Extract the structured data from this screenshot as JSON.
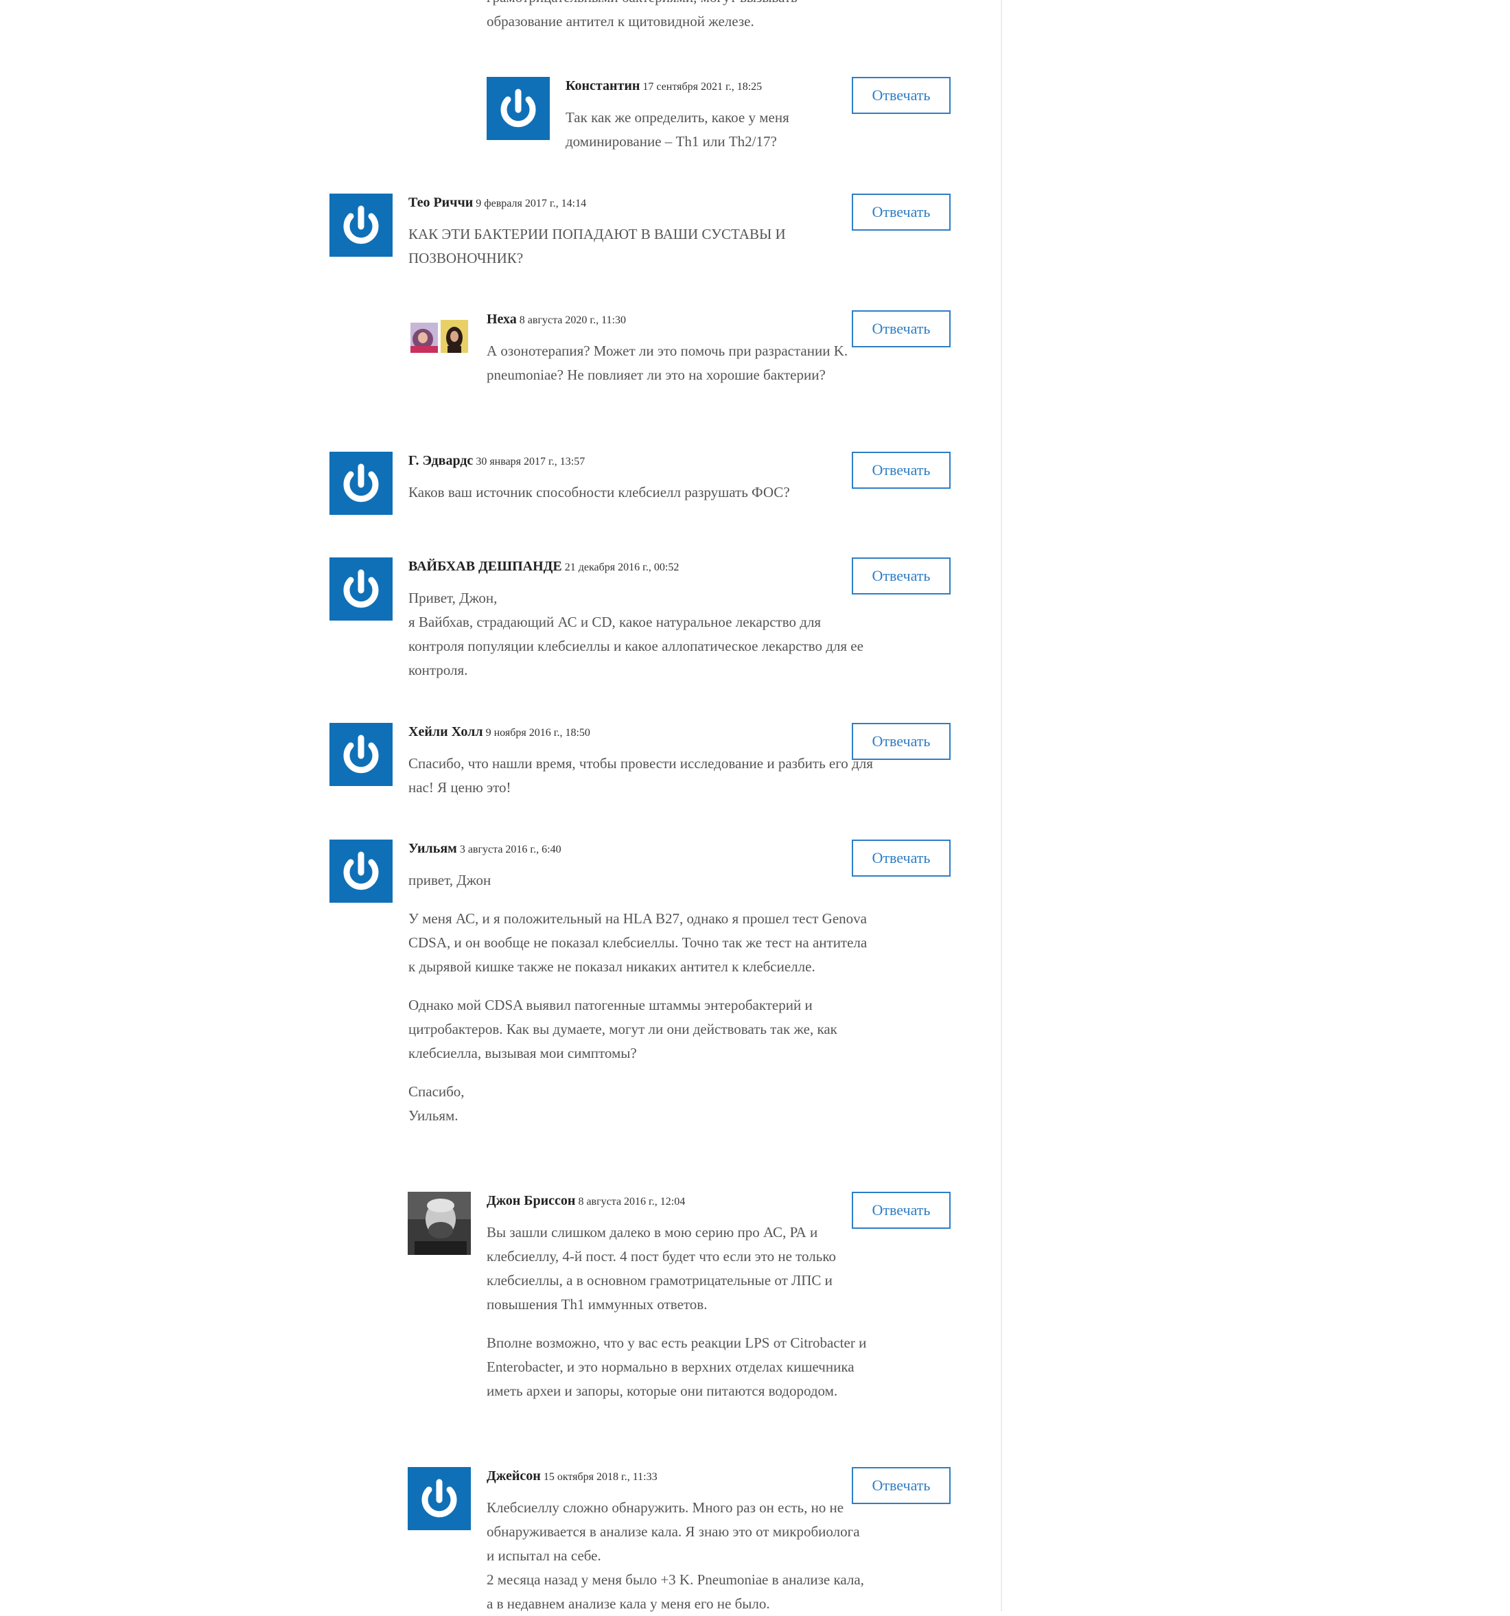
{
  "reply_label": "Отвечать",
  "accent_color": "#2e7ec5",
  "avatar_color": "#0f70b7",
  "partial_text": {
    "line1": "грамотрицательными бактериями, могут вызывать",
    "line2": "образование антител к щитовидной железе."
  },
  "comments": [
    {
      "author": "Константин",
      "date": "17 сентября 2021 г., 18:25",
      "avatar": "power-icon",
      "paragraphs": [
        "Так как же определить, какое у меня доминирование – Th1 или Th2/17?"
      ]
    },
    {
      "author": "Тео Риччи",
      "date": "9 февраля 2017 г., 14:14",
      "avatar": "power-icon",
      "paragraphs": [
        "КАК ЭТИ БАКТЕРИИ ПОПАДАЮТ В ВАШИ СУСТАВЫ И ПОЗВОНОЧНИК?"
      ]
    },
    {
      "author": "Неха",
      "date": "8 августа 2020 г., 11:30",
      "avatar": "collage-photo",
      "paragraphs": [
        "А озонотерапия? Может ли это помочь при разрастании K. pneumoniae? Не повлияет ли это на хорошие бактерии?"
      ]
    },
    {
      "author": "Г. Эдвардс",
      "date": "30 января 2017 г., 13:57",
      "avatar": "power-icon",
      "paragraphs": [
        "Каков ваш источник способности клебсиелл разрушать ФОС?"
      ]
    },
    {
      "author": "ВАЙБХАВ ДЕШПАНДЕ",
      "date": "21 декабря 2016 г., 00:52",
      "avatar": "power-icon",
      "paragraphs": [
        "Привет, Джон,",
        "я Вайбхав, страдающий АС и CD, какое натуральное лекарство для контроля популяции клебсиеллы и какое аллопатическое лекарство для ее контроля."
      ]
    },
    {
      "author": "Хейли Холл",
      "date": "9 ноября 2016 г., 18:50",
      "avatar": "power-icon",
      "paragraphs": [
        "Спасибо, что нашли время, чтобы провести исследование и разбить его для нас! Я ценю это!"
      ]
    },
    {
      "author": "Уильям",
      "date": "3 августа 2016 г., 6:40",
      "avatar": "power-icon",
      "paragraphs": [
        "привет, Джон",
        "У меня АС, и я положительный на HLA B27, однако я прошел тест Genova CDSA, и он вообще не показал клебсиеллы. Точно так же тест на антитела к дырявой кишке также не показал никаких антител к клебсиелле.",
        "Однако мой CDSA выявил патогенные штаммы энтеробактерий и цитробактеров. Как вы думаете, могут ли они действовать так же, как клебсиелла, вызывая мои симптомы?",
        "Спасибо,",
        "Уильям."
      ]
    },
    {
      "author": "Джон Бриссон",
      "date": "8 августа 2016 г., 12:04",
      "avatar": "portrait-photo",
      "paragraphs": [
        "Вы зашли слишком далеко в мою серию про АС, РА и клебсиеллу, 4-й пост. 4 пост будет что если это не только клебсиеллы, а в основном грамотрицательные от ЛПС и повышения Th1 иммунных ответов.",
        "Вполне возможно, что у вас есть реакции LPS от Citrobacter и Enterobacter, и это нормально в верхних отделах кишечника иметь археи и запоры, которые они питаются водородом."
      ]
    },
    {
      "author": "Джейсон",
      "date": "15 октября 2018 г., 11:33",
      "avatar": "power-icon",
      "paragraphs": [
        "Клебсиеллу сложно обнаружить. Много раз он есть, но не обнаруживается в анализе кала. Я знаю это от микробиолога и испытал на себе.",
        "2 месяца назад у меня было +3 K. Pneumoniae в анализе кала, а в недавнем анализе кала у меня его не было."
      ]
    }
  ]
}
